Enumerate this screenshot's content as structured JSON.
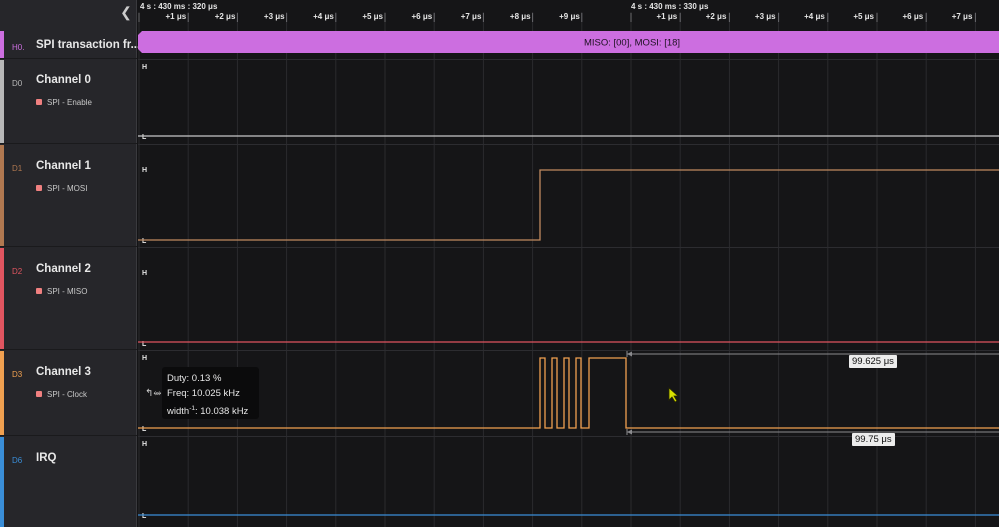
{
  "sidebar": {
    "collapse_icon": "chevron-left-icon",
    "rows": [
      {
        "index": "H0.",
        "title": "SPI transaction fr...",
        "subtitle": "",
        "color": "#cc6ee0"
      },
      {
        "index": "D0",
        "title": "Channel 0",
        "subtitle": "SPI - Enable",
        "color": "#b8b8b8"
      },
      {
        "index": "D1",
        "title": "Channel 1",
        "subtitle": "SPI - MOSI",
        "color": "#b07850"
      },
      {
        "index": "D2",
        "title": "Channel 2",
        "subtitle": "SPI - MISO",
        "color": "#e05560"
      },
      {
        "index": "D3",
        "title": "Channel 3",
        "subtitle": "SPI - Clock",
        "color": "#f0a050"
      },
      {
        "index": "D6",
        "title": "IRQ",
        "subtitle": "",
        "color": "#3a8ed8"
      }
    ]
  },
  "timeline": {
    "anchor1": "4 s : 430 ms : 320 μs",
    "anchor2": "4 s : 430 ms : 330 μs",
    "ticks1": [
      "+1 μs",
      "+2 μs",
      "+3 μs",
      "+4 μs",
      "+5 μs",
      "+6 μs",
      "+7 μs",
      "+8 μs",
      "+9 μs"
    ],
    "ticks2": [
      "+1 μs",
      "+2 μs",
      "+3 μs",
      "+4 μs",
      "+5 μs",
      "+6 μs",
      "+7 μs"
    ]
  },
  "analyzer": {
    "frame_text": "MISO: [00], MOSI: [18]",
    "color": "#cc6ee0"
  },
  "level_labels": {
    "high": "H",
    "low": "L"
  },
  "tooltip": {
    "duty": "Duty: 0.13 %",
    "freq": "Freq: 10.025 kHz",
    "width_prefix": "width",
    "width_sup": "-1",
    "width_suffix": ": 10.038 kHz"
  },
  "measurements": {
    "high_width": "99.625 μs",
    "low_width": "99.75 μs"
  }
}
